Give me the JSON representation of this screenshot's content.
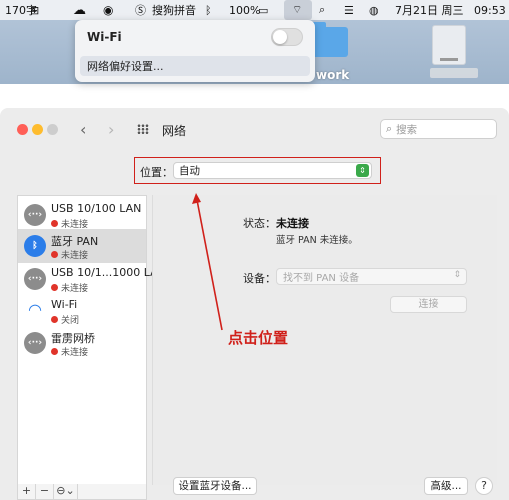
{
  "menubar": {
    "input_label": "170字",
    "pinyin_label": "搜狗拼音",
    "battery": "100%",
    "datetime": "7月21日 周三",
    "time": "09:53"
  },
  "wifi_menu": {
    "title": "Wi-Fi",
    "toggle_on": false,
    "preferences": "网络偏好设置..."
  },
  "desktop": {
    "label": "work"
  },
  "window": {
    "title": "网络",
    "search_placeholder": "搜索",
    "location_label": "位置：",
    "location_value": "自动"
  },
  "services": [
    {
      "name": "USB 10/100 LAN",
      "status": "未连接",
      "icon": "ethernet-icon"
    },
    {
      "name": "蓝牙 PAN",
      "status": "未连接",
      "icon": "bluetooth-icon"
    },
    {
      "name": "USB 10/1...1000 LAN",
      "status": "未连接",
      "icon": "ethernet-icon"
    },
    {
      "name": "Wi-Fi",
      "status": "关闭",
      "icon": "wifi-icon"
    },
    {
      "name": "雷雳网桥",
      "status": "未连接",
      "icon": "ethernet-icon"
    }
  ],
  "sidebar_bottom": {
    "add": "+",
    "remove": "−",
    "more": "⊖⌄"
  },
  "detail": {
    "status_label": "状态：",
    "status_value": "未连接",
    "status_desc": "蓝牙 PAN 未连接。",
    "device_label": "设备：",
    "device_placeholder": "找不到 PAN 设备",
    "connect": "连接",
    "setup_bt": "设置蓝牙设备...",
    "advanced": "高级...",
    "help": "?"
  },
  "annotation": {
    "text": "点击位置",
    "color": "#d0201a"
  }
}
